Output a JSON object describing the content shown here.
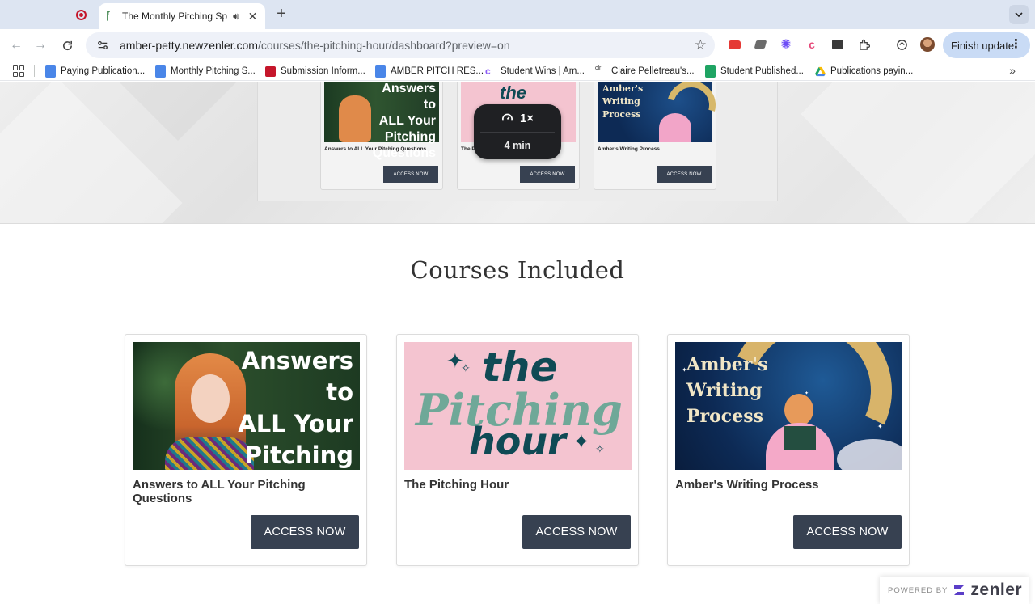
{
  "browser": {
    "tab_title": "The Monthly Pitching Spri",
    "url_host": "amber-petty.newzenler.com",
    "url_path": "/courses/the-pitching-hour/dashboard?preview=on",
    "finish_update_label": "Finish update",
    "bookmarks": [
      {
        "label": "Paying Publication...",
        "icon": "docs-icon",
        "color": "#4a86e8"
      },
      {
        "label": "Monthly Pitching S...",
        "icon": "docs-icon",
        "color": "#4a86e8"
      },
      {
        "label": "Submission Inform...",
        "icon": "red-square-icon",
        "color": "#c5162b"
      },
      {
        "label": "AMBER PITCH RES...",
        "icon": "docs-icon",
        "color": "#4a86e8"
      },
      {
        "label": "Student Wins | Am...",
        "icon": "c-logo-icon",
        "color": "#8b5cf6"
      },
      {
        "label": "Claire Pelletreau's...",
        "icon": "claire-icon",
        "color": "#444444"
      },
      {
        "label": "Student Published...",
        "icon": "sheets-icon",
        "color": "#1fa463"
      },
      {
        "label": "Publications payin...",
        "icon": "drive-icon",
        "color": "#fbbc04"
      }
    ]
  },
  "player": {
    "speed": "1×",
    "duration": "4 min"
  },
  "section_title": "Courses Included",
  "courses": [
    {
      "title": "Answers to ALL Your Pitching Questions",
      "button": "ACCESS NOW",
      "thumb_text": [
        "Answers to",
        "ALL Your",
        "Pitching",
        "Questions"
      ]
    },
    {
      "title": "The Pitching Hour",
      "button": "ACCESS NOW",
      "thumb_text": [
        "the",
        "Pitching",
        "hour"
      ]
    },
    {
      "title": "Amber's Writing Process",
      "button": "ACCESS NOW",
      "thumb_text": [
        "Amber's",
        "Writing",
        "Process"
      ]
    }
  ],
  "mini_courses": [
    {
      "title": "Answers to ALL Your Pitching Questions",
      "button": "ACCESS NOW"
    },
    {
      "title": "The Pi",
      "button": "ACCESS NOW"
    },
    {
      "title": "Amber's Writing Process",
      "button": "ACCESS NOW"
    }
  ],
  "powered_by": {
    "label": "POWERED BY",
    "brand": "zenler"
  },
  "colors": {
    "button_bg": "#374151",
    "pitching_pink": "#f4c4d0",
    "pitching_teal": "#0f4a55",
    "pitching_green": "#6fa898",
    "night_blue": "#0d2a55"
  }
}
